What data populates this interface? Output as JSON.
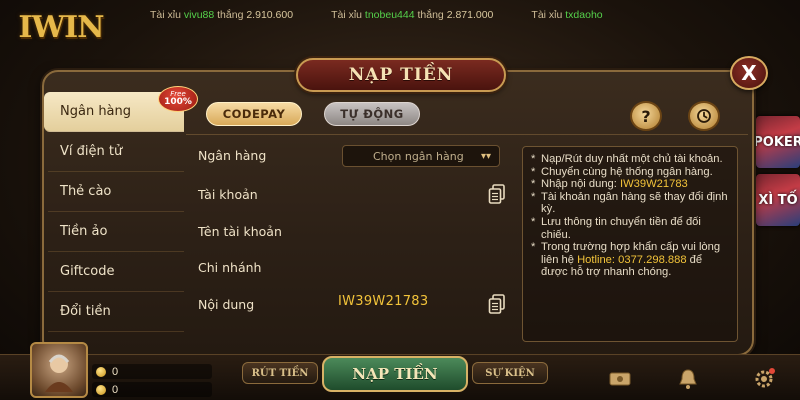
{
  "ticker": [
    {
      "prefix": "Tài xỉu",
      "user": "vivu88",
      "mid": "thắng",
      "amount": "2.910.600"
    },
    {
      "prefix": "Tài xỉu",
      "user": "tnobeu444",
      "mid": "thắng",
      "amount": "2.871.000"
    },
    {
      "prefix": "Tài xỉu",
      "user": "txdaoho",
      "mid": "",
      "amount": ""
    }
  ],
  "logo": "IWIN",
  "dialog": {
    "title": "NẠP TIỀN",
    "close_label": "X"
  },
  "sidebar": {
    "items": [
      {
        "label": "Ngân hàng"
      },
      {
        "label": "Ví điện tử"
      },
      {
        "label": "Thẻ cào"
      },
      {
        "label": "Tiền ảo"
      },
      {
        "label": "Giftcode"
      },
      {
        "label": "Đổi tiền"
      }
    ],
    "badge_top": "Free",
    "badge_bottom": "100%"
  },
  "tabs": [
    {
      "label": "CODEPAY"
    },
    {
      "label": "TỰ ĐỘNG"
    }
  ],
  "help_label": "?",
  "form": {
    "bank_label": "Ngân hàng",
    "bank_select_value": "Chọn ngân hàng",
    "account_label": "Tài khoản",
    "account_name_label": "Tên tài khoản",
    "branch_label": "Chi nhánh",
    "content_label": "Nội dung",
    "content_value": "IW39W21783"
  },
  "notes": {
    "n1": "Nạp/Rút duy nhất một chủ tài khoản.",
    "n2": "Chuyển cùng hệ thống ngân hàng.",
    "n3_prefix": "Nhập nội dung:",
    "n3_code": "IW39W21783",
    "n4": "Tài khoản ngân hàng sẽ thay đổi định kỳ.",
    "n5": "Lưu thông tin chuyển tiền để đối chiếu.",
    "n6_prefix": "Trong trường hợp khẩn cấp vui lòng liên hệ",
    "n6_hotline_label": "Hotline:",
    "n6_phone": "0377.298.888",
    "n6_suffix": "để được hỗ trợ nhanh chóng."
  },
  "bottom": {
    "balance1": "0",
    "balance2": "0",
    "withdraw_label": "RÚT TIỀN",
    "deposit_label": "NẠP TIỀN",
    "event_label": "SỰ KIỆN"
  },
  "bg_cards": [
    "POKER",
    "XÌ TỐ"
  ]
}
